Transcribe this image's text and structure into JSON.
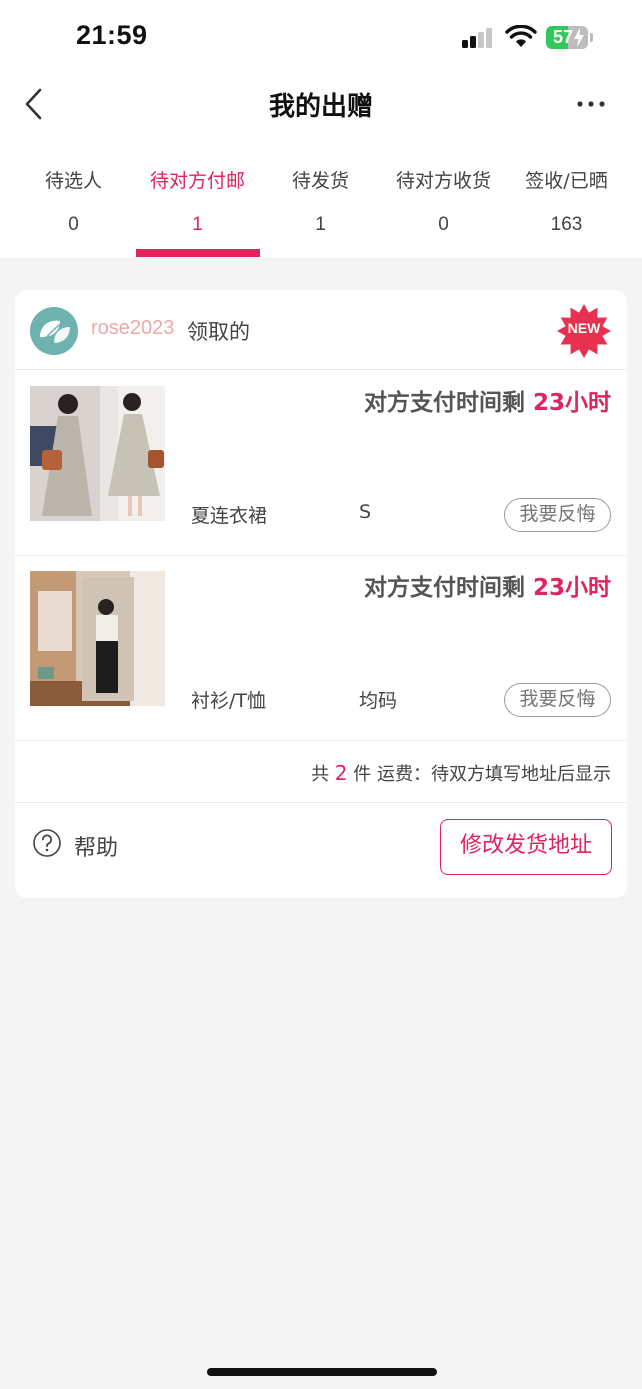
{
  "status_bar": {
    "time": "21:59",
    "battery_level": "57",
    "icons": [
      "cellular-signal-icon",
      "wifi-icon",
      "battery-charging-icon"
    ]
  },
  "nav": {
    "title": "我的出赠",
    "back_icon": "chevron-left-icon",
    "more_icon": "more-dots-icon"
  },
  "tabs": [
    {
      "label": "待选人",
      "count": "0",
      "active": false
    },
    {
      "label": "待对方付邮",
      "count": "1",
      "active": true
    },
    {
      "label": "待发货",
      "count": "1",
      "active": false
    },
    {
      "label": "待对方收货",
      "count": "0",
      "active": false
    },
    {
      "label": "签收/已晒",
      "count": "163",
      "active": false
    }
  ],
  "order": {
    "username": "rose2023",
    "claimed_text": "领取的",
    "badge": "NEW",
    "items": [
      {
        "pay_prefix": "对方支付时间剩",
        "pay_time": "23小时",
        "name": "夏连衣裙",
        "size": "S",
        "regret_label": "我要反悔"
      },
      {
        "pay_prefix": "对方支付时间剩",
        "pay_time": "23小时",
        "name": "衬衫/T恤",
        "size": "均码",
        "regret_label": "我要反悔"
      }
    ],
    "summary": {
      "prefix": "共",
      "count": "2",
      "suffix": "件 运费：待双方填写地址后显示"
    },
    "help_label": "帮助",
    "change_address_label": "修改发货地址"
  },
  "colors": {
    "accent": "#e0245e",
    "username": "#f0a6a6",
    "background": "#f4f4f4"
  }
}
